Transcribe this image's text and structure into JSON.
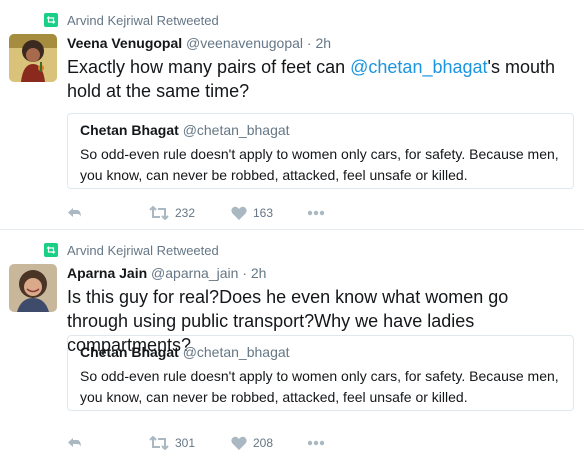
{
  "tweets": [
    {
      "retweeted_by": "Arvind Kejriwal Retweeted",
      "author_name": "Veena Venugopal",
      "author_handle": "@veenavenugopal",
      "time": "2h",
      "text_before": "Exactly how many pairs of feet can ",
      "mention": "@chetan_bhagat",
      "text_after": "'s mouth hold at the same time?",
      "quote": {
        "author_name": "Chetan Bhagat",
        "author_handle": "@chetan_bhagat",
        "text": "So odd-even rule doesn't apply to women only cars, for safety. Because men, you know, can never be robbed, attacked, feel unsafe or killed."
      },
      "retweets": "232",
      "likes": "163"
    },
    {
      "retweeted_by": "Arvind Kejriwal Retweeted",
      "author_name": "Aparna Jain",
      "author_handle": "@aparna_jain",
      "time": "2h",
      "text": "Is this guy for real?Does he even know what women go through using public transport?Why we have ladies compartments?",
      "quote": {
        "author_name": "Chetan Bhagat",
        "author_handle": "@chetan_bhagat",
        "text": "So odd-even rule doesn't apply to women only cars, for safety. Because men, you know, can never be robbed, attacked, feel unsafe or killed."
      },
      "retweets": "301",
      "likes": "208"
    }
  ],
  "icons": {
    "retweeted_badge": "retweet-icon",
    "reply": "reply-icon",
    "retweet": "retweet-icon",
    "like": "heart-icon",
    "more": "more-icon"
  },
  "colors": {
    "retweet_green": "#19cf86",
    "link_blue": "#1b95e0",
    "meta_gray": "#657786",
    "action_gray": "#aab8c2"
  }
}
